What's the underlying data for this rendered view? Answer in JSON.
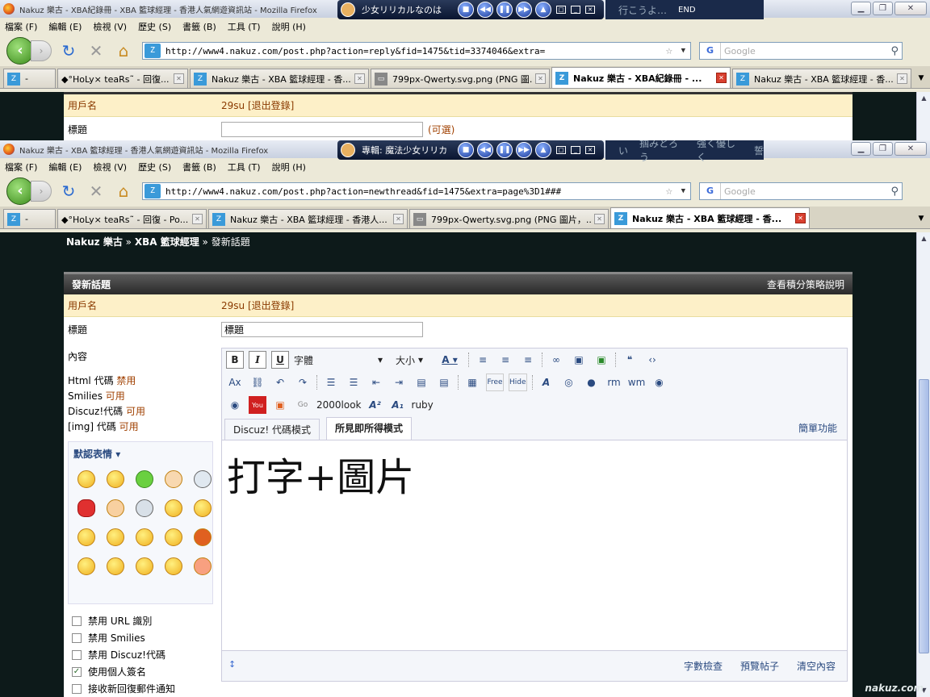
{
  "win1": {
    "title": "Nakuz 樂古 - XBA紀錄冊 - XBA 籃球經理 - 香港人氣網遊資訊站 - Mozilla Firefox",
    "player_text": "少女リリカルなのは",
    "lyrics": [
      "行こうよ…",
      "END"
    ],
    "menu": [
      "檔案 (F)",
      "編輯 (E)",
      "檢視 (V)",
      "歷史 (S)",
      "書籤 (B)",
      "工具 (T)",
      "說明 (H)"
    ],
    "url": "http://www4.nakuz.com/post.php?action=reply&fid=1475&tid=3374046&extra=",
    "search_placeholder": "Google",
    "tabs": [
      {
        "label": "-"
      },
      {
        "label": "◆°HoLy× teaRs˜ - 回復..."
      },
      {
        "label": "Nakuz 樂古 - XBA 籃球經理 - 香..."
      },
      {
        "label": "799px-Qwerty.svg.png (PNG 圖..."
      },
      {
        "label": "Nakuz 樂古 - XBA紀錄冊 - ...",
        "active": true
      },
      {
        "label": "Nakuz 樂古 - XBA 籃球經理 - 香..."
      }
    ],
    "user_label": "用戶名",
    "user_value": "29su [退出登錄]",
    "title_label": "標題",
    "optional": "(可選)"
  },
  "win2": {
    "title": "Nakuz 樂古 - XBA 籃球經理 - 香港人氣網遊資訊站 - Mozilla Firefox",
    "player_text": "專輯: 魔法少女リリカ",
    "lyrics": [
      "い",
      "掴みとろう",
      "強く優しく",
      "誓"
    ],
    "menu": [
      "檔案 (F)",
      "編輯 (E)",
      "檢視 (V)",
      "歷史 (S)",
      "書籤 (B)",
      "工具 (T)",
      "說明 (H)"
    ],
    "url": "http://www4.nakuz.com/post.php?action=newthread&fid=1475&extra=page%3D1###",
    "search_placeholder": "Google",
    "tabs": [
      {
        "label": "-"
      },
      {
        "label": "◆°HoLy× teaRs˜ - 回復 - Po..."
      },
      {
        "label": "Nakuz 樂古 - XBA 籃球經理 - 香港人..."
      },
      {
        "label": "799px-Qwerty.svg.png (PNG 圖片，..."
      },
      {
        "label": "Nakuz 樂古 - XBA 籃球經理 - 香...",
        "active": true
      }
    ]
  },
  "breadcrumb": {
    "site": "Nakuz 樂古",
    "sep": "»",
    "forum": "XBA 籃球經理",
    "current": "發新話題"
  },
  "form": {
    "header": "發新話題",
    "header_link": "查看積分策略說明",
    "user_label": "用戶名",
    "user_value": "29su [退出登錄]",
    "title_label": "標題",
    "title_value": "標題",
    "content_label": "內容"
  },
  "permissions": [
    {
      "name": "Html 代碼",
      "state": "禁用"
    },
    {
      "name": "Smilies",
      "state": "可用"
    },
    {
      "name": "Discuz!代碼",
      "state": "可用"
    },
    {
      "name": "[img] 代碼",
      "state": "可用"
    }
  ],
  "smilies_title": "默認表情",
  "options": [
    {
      "label": "禁用 URL 識別",
      "checked": false
    },
    {
      "label": "禁用 Smilies",
      "checked": false
    },
    {
      "label": "禁用 Discuz!代碼",
      "checked": false
    },
    {
      "label": "使用個人簽名",
      "checked": true
    },
    {
      "label": "接收新回復郵件通知",
      "checked": false
    }
  ],
  "editor": {
    "font_select": "字體",
    "size_select": "大小",
    "extra_2000look": "2000look",
    "extra_ruby": "ruby",
    "tab_code": "Discuz! 代碼模式",
    "tab_wysiwyg": "所見即所得模式",
    "simple": "簡單功能",
    "content": "打字+圖片",
    "foot": [
      "字數檢查",
      "預覽帖子",
      "清空內容"
    ]
  },
  "watermark": "nakuz.com"
}
